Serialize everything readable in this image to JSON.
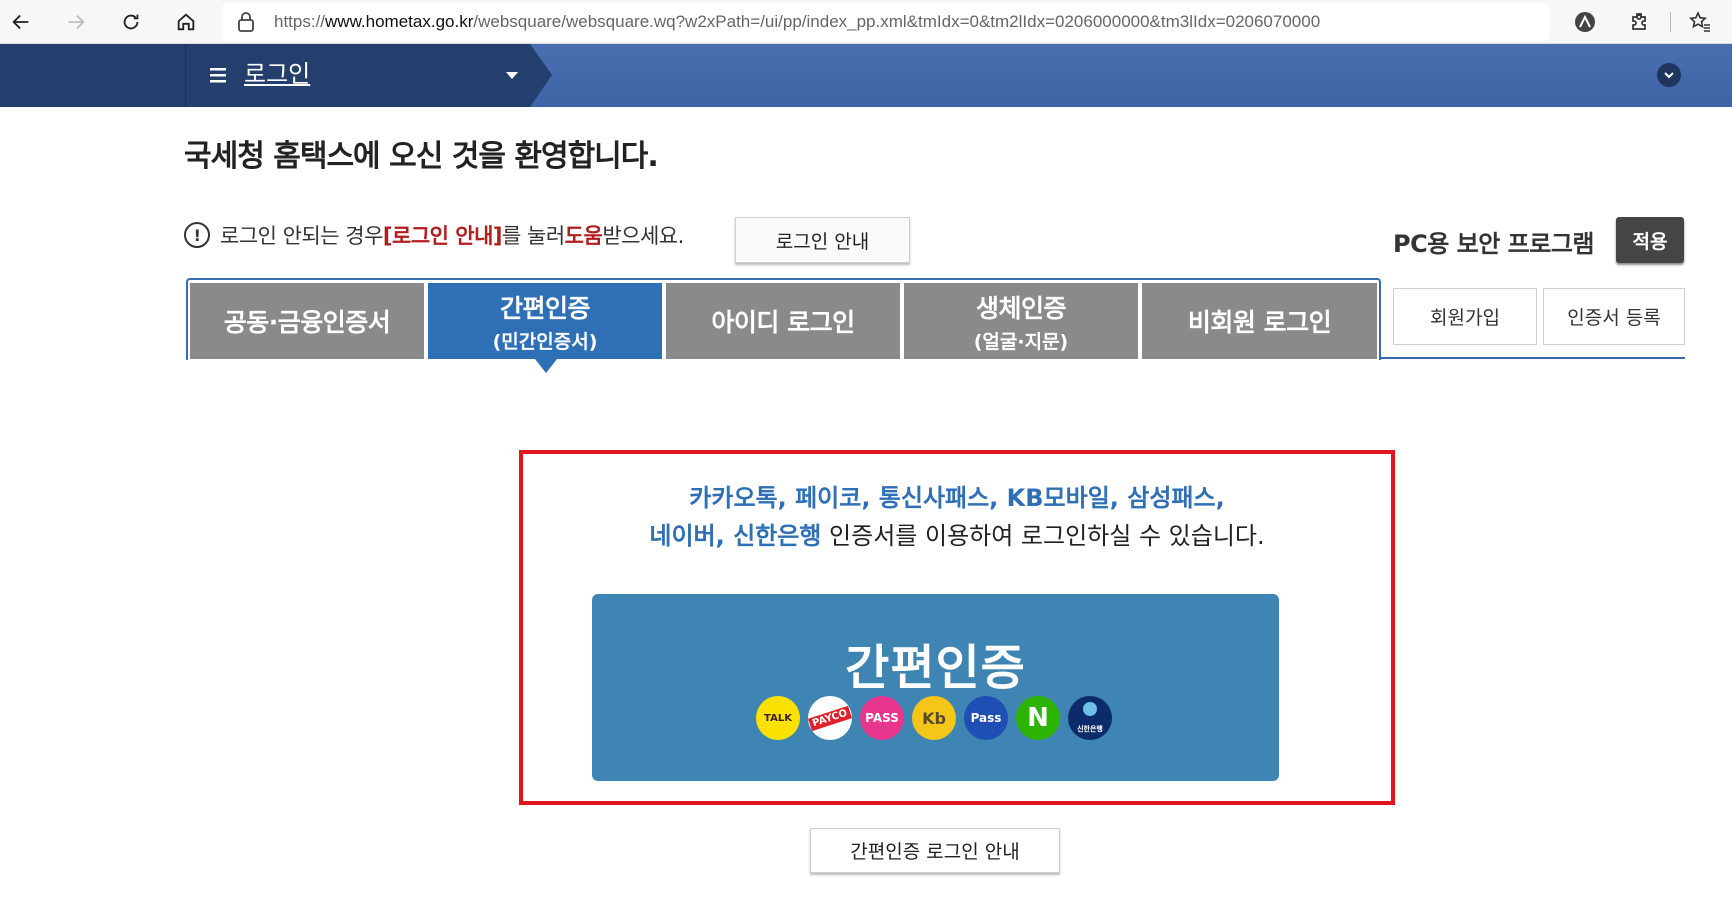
{
  "browser": {
    "url_prefix": "https://",
    "url_domain": "www.hometax.go.kr",
    "url_rest": "/websquare/websquare.wq?w2xPath=/ui/pp/index_pp.xml&tmIdx=0&tm2lIdx=0206000000&tm3lIdx=0206070000"
  },
  "header": {
    "menu_title": "로그인"
  },
  "welcome": "국세청 홈택스에 오신 것을 환영합니다.",
  "notice": {
    "icon_char": "!",
    "part1": "로그인 안되는 경우 ",
    "highlight1": "[로그인 안내]",
    "part2": "를 눌러 ",
    "highlight2": "도움",
    "part3": "받으세요.",
    "button": "로그인 안내"
  },
  "pc_security": {
    "label": "PC용 보안 프로그램",
    "button": "적용"
  },
  "tabs": [
    {
      "line1": "공동·금융인증서",
      "line2": ""
    },
    {
      "line1": "간편인증",
      "line2": "(민간인증서)"
    },
    {
      "line1": "아이디 로그인",
      "line2": ""
    },
    {
      "line1": "생체인증",
      "line2": "(얼굴·지문)"
    },
    {
      "line1": "비회원 로그인",
      "line2": ""
    }
  ],
  "side_buttons": {
    "signup": "회원가입",
    "cert_register": "인증서 등록"
  },
  "simple_auth": {
    "desc_blue_line1": "카카오톡, 페이코, 통신사패스, KB모바일, 삼성패스,",
    "desc_blue_line2": "네이버, 신한은행",
    "desc_plain_line2": " 인증서를 이용하여 로그인하실 수 있습니다.",
    "button_title": "간편인증",
    "logos": [
      {
        "name": "kakaotalk-logo",
        "text": "TALK",
        "bg": "#fae100",
        "fg": "#3c1e1e"
      },
      {
        "name": "payco-logo",
        "text": "PAYCO",
        "bg": "#ffffff",
        "fg": "#ffffff"
      },
      {
        "name": "pass-logo",
        "text": "PASS",
        "bg": "#e8368f",
        "fg": "#ffffff"
      },
      {
        "name": "kb-logo",
        "text": "Kb",
        "bg": "#f5c518",
        "fg": "#5a4a2a"
      },
      {
        "name": "samsung-pass-logo",
        "text": "Pass",
        "bg": "#1f4fb5",
        "fg": "#ffffff"
      },
      {
        "name": "naver-logo",
        "text": "N",
        "bg": "#2db400",
        "fg": "#ffffff"
      },
      {
        "name": "shinhan-logo",
        "text": "신한은행",
        "bg": "#0d2a6b",
        "fg": "#ffffff"
      }
    ]
  },
  "bottom_guide": "간편인증 로그인 안내"
}
